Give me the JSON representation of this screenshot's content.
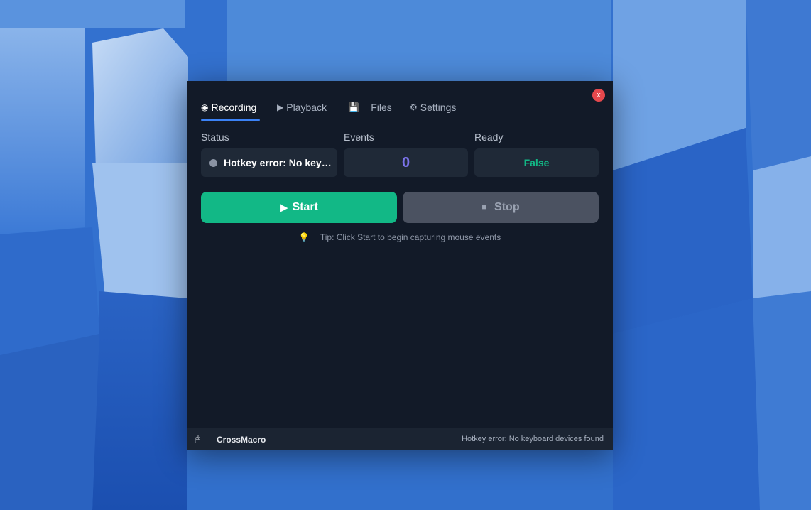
{
  "tabs": [
    {
      "icon": "◉",
      "label": "Recording"
    },
    {
      "icon": "▶",
      "label": "Playback"
    },
    {
      "icon": "💾",
      "label": "Files"
    },
    {
      "icon": "⚙",
      "label": "Settings"
    }
  ],
  "close_label": "x",
  "status": {
    "label": "Status",
    "value": "Hotkey error: No keyboard devices found",
    "dot_color": "#8a93a3"
  },
  "events": {
    "label": "Events",
    "value": "0"
  },
  "ready": {
    "label": "Ready",
    "value": "False"
  },
  "start_button": {
    "icon": "▶",
    "label": "Start"
  },
  "stop_button": {
    "icon": "■",
    "label": "Stop"
  },
  "tip": {
    "icon": "💡",
    "text": "Tip: Click Start to begin capturing mouse events"
  },
  "statusbar": {
    "icon": "🖱",
    "app_name": "CrossMacro",
    "message": "Hotkey error: No keyboard devices found"
  },
  "colors": {
    "window_bg": "#121a28",
    "card_bg": "#1f2937",
    "accent_green": "#12b886",
    "accent_purple": "#7b73ea",
    "tab_underline": "#3b82f6",
    "close_red": "#e5484d"
  }
}
